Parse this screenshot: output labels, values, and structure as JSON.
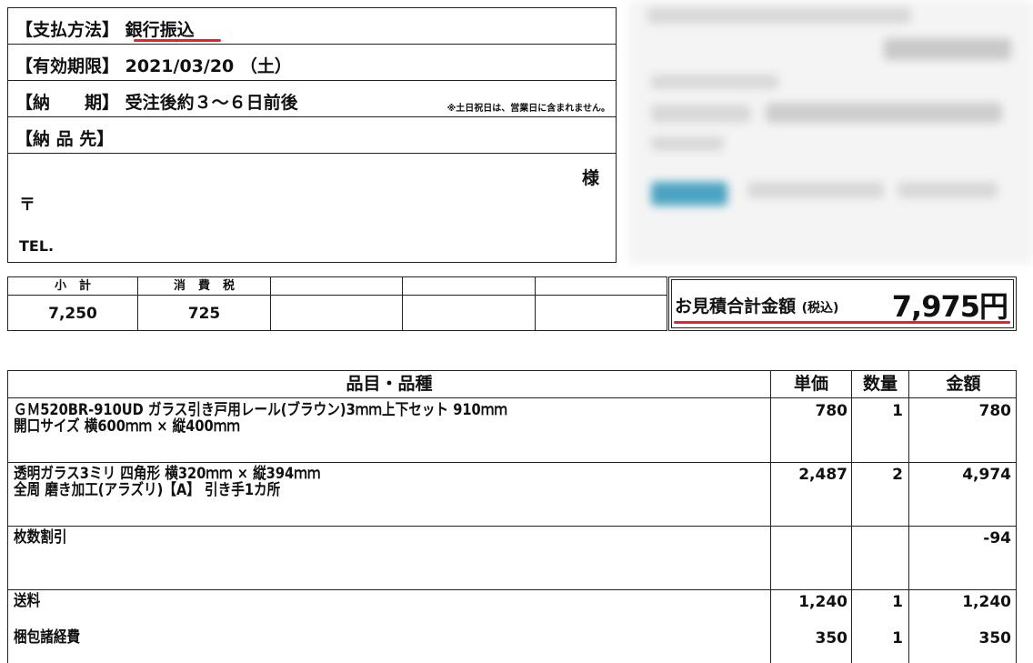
{
  "info": {
    "payment_label": "【支払方法】",
    "payment_value": "銀行振込",
    "expiry_label": "【有効期限】",
    "expiry_value": "2021/03/20 （土）",
    "delivery_label": "【納　　期】",
    "delivery_value": "受注後約３～６日前後",
    "delivery_note": "※土日祝日は、営業日に含まれません。",
    "dest_label": "【納 品 先】",
    "honorific": "様",
    "postal_mark": "〒",
    "tel_label": "TEL."
  },
  "colors": {
    "accent_underline": "#e8222b"
  },
  "summary": {
    "subtotal_label": "小計",
    "tax_label": "消費税",
    "subtotal_value": "7,250",
    "tax_value": "725",
    "total_label": "お見積合計金額",
    "total_tax_note": "(税込)",
    "total_value": "7,975円"
  },
  "items": {
    "headers": {
      "name": "品目・品種",
      "unit_price": "単価",
      "qty": "数量",
      "amount": "金額"
    },
    "rows": [
      {
        "line1": "ＧＭ520BR-910UD ガラス引き戸用レール(ブラウン)3ｍｍ上下セット 910ｍｍ",
        "line2": "開口サイズ 横600ｍｍ × 縦400ｍｍ",
        "unit_price": "780",
        "qty": "1",
        "amount": "780"
      },
      {
        "line1": "透明ガラス3ミリ 四角形 横320ｍｍ × 縦394ｍｍ",
        "line2": " 全周 磨き加工(アラズリ)【A】 引き手1カ所",
        "unit_price": "2,487",
        "qty": "2",
        "amount": "4,974"
      },
      {
        "line1": "枚数割引",
        "line2": "",
        "unit_price": "",
        "qty": "",
        "amount": "-94"
      },
      {
        "line1": "送料",
        "line2": "",
        "unit_price": "1,240",
        "qty": "1",
        "amount": "1,240"
      },
      {
        "line1": "梱包諸経費",
        "line2": "",
        "unit_price": "350",
        "qty": "1",
        "amount": "350"
      }
    ]
  }
}
